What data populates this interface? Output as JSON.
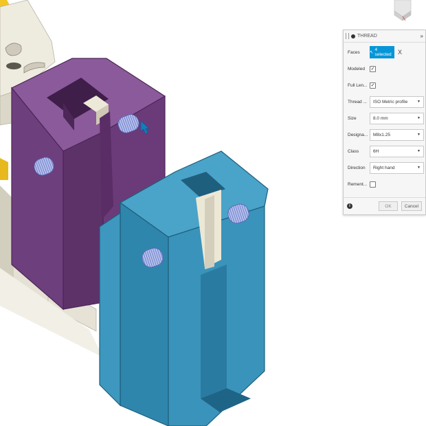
{
  "dialog": {
    "title": "THREAD",
    "expand_glyph": "»",
    "rows": [
      {
        "label": "Faces"
      },
      {
        "label": "Modeled",
        "checked": true
      },
      {
        "label": "Full Len...",
        "checked": true
      },
      {
        "label": "Thread ...",
        "value": "ISO Metric profile"
      },
      {
        "label": "Size",
        "value": "8.0 mm"
      },
      {
        "label": "Designa...",
        "value": "M8x1.25"
      },
      {
        "label": "Class",
        "value": "6H"
      },
      {
        "label": "Direction",
        "value": "Right hand"
      },
      {
        "label": "Rement...",
        "checked": false
      }
    ],
    "faces_selected": "4 selected",
    "clear_glyph": "X",
    "ok_label": "OK",
    "cancel_label": "Cancel",
    "info_glyph": "i"
  },
  "colors": {
    "purple_body": "#6e3f7d",
    "blue_body": "#3a93ba",
    "accent": "#0696d7",
    "bed": "#e9e6da",
    "yellow_edge": "#f3c623"
  },
  "icons": [
    "view-cube-icon",
    "cursor-icon",
    "info-icon",
    "thread-marker-icon",
    "chevron-down-icon"
  ]
}
